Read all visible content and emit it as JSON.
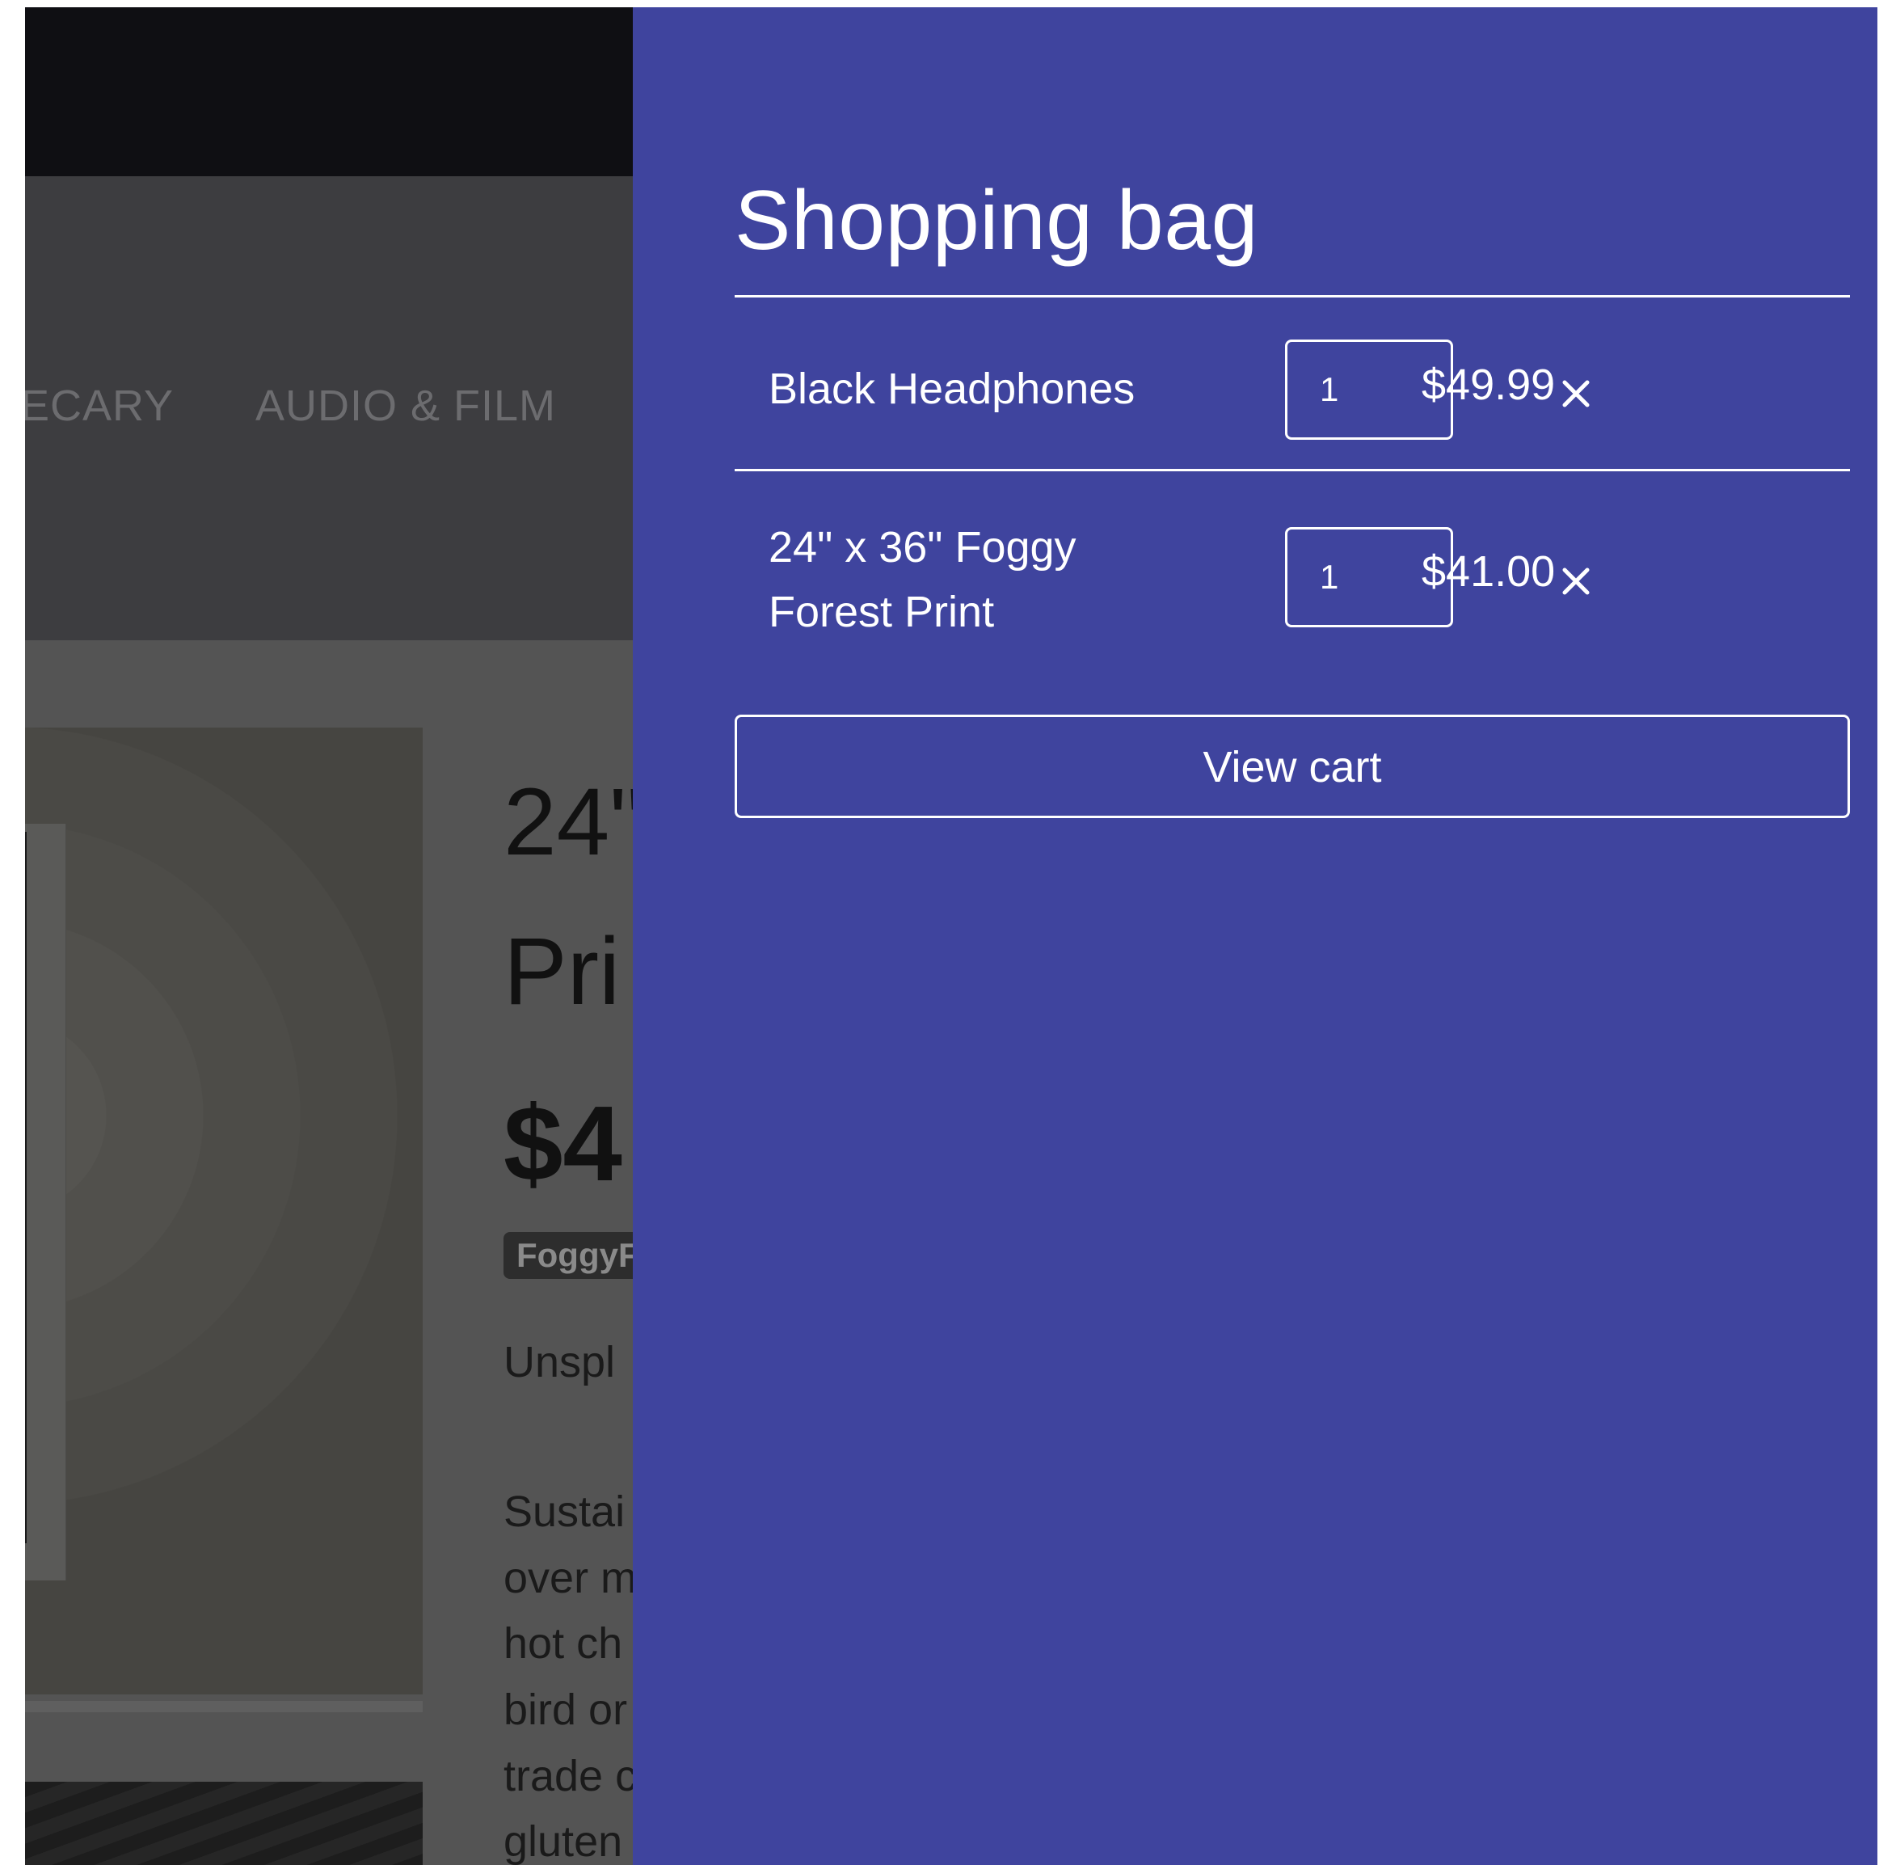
{
  "background_page": {
    "nav_items": [
      "ECARY",
      "AUDIO & FILM"
    ],
    "product_title_line1": "24\"",
    "product_title_line2": "Pri",
    "product_price": "$4",
    "product_tag": "FoggyF",
    "description_lines": [
      "Unspl",
      "",
      "Sustai",
      "over m",
      "hot ch",
      "bird or",
      "trade c",
      "gluten"
    ]
  },
  "cart": {
    "title": "Shopping bag",
    "items": [
      {
        "name": "Black Headphones",
        "quantity": "1",
        "price": "$49.99"
      },
      {
        "name_line1": "24\" x 36\" Foggy",
        "name_line2": "Forest Print",
        "quantity": "1",
        "price": "$41.00"
      }
    ],
    "view_cart_label": "View cart",
    "colors": {
      "drawer_background": "#3f449e",
      "foreground": "#ffffff"
    },
    "remove_icon": "close-icon"
  }
}
